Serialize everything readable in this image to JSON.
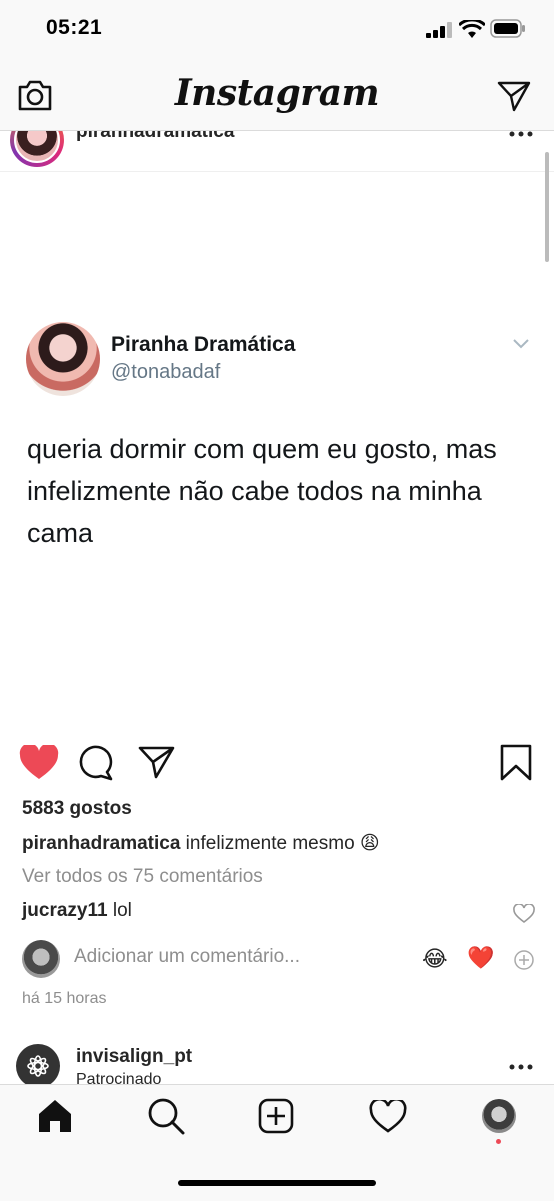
{
  "status_bar": {
    "time": "05:21"
  },
  "top_nav": {
    "logo": "Instagram"
  },
  "post": {
    "username": "piranhadramatica",
    "tweet": {
      "name": "Piranha Dramática",
      "handle": "@tonabadaf",
      "text": "queria dormir com quem eu gosto, mas infelizmente não cabe todos na minha cama"
    },
    "likes": "5883 gostos",
    "caption_user": "piranhadramatica",
    "caption_text": " infelizmente mesmo 😩",
    "view_comments": "Ver todos os 75 comentários",
    "comment_user": "jucrazy11",
    "comment_text": " lol",
    "add_comment_placeholder": "Adicionar um comentário...",
    "quick_emojis": [
      "😂",
      "❤️"
    ],
    "timestamp": "há 15 horas",
    "liked": true
  },
  "next_post": {
    "username": "invisalign_pt",
    "sponsored": "Patrocinado"
  },
  "colors": {
    "like_red": "#ed4956",
    "muted": "#8e8e8e",
    "text": "#262626"
  }
}
